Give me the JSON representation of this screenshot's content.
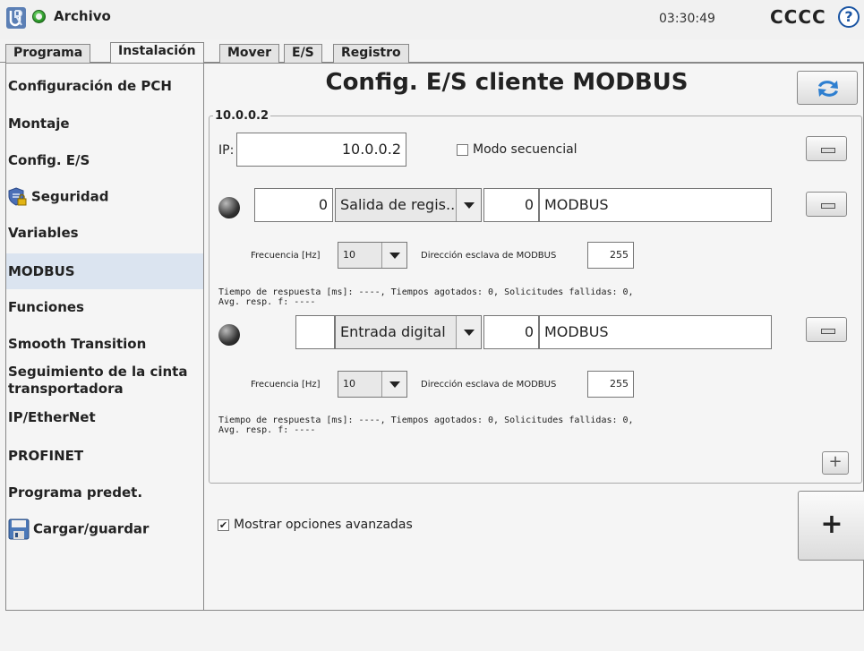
{
  "topbar": {
    "file_label": "Archivo",
    "clock": "03:30:49",
    "robot_name": "CCCC",
    "help": "?"
  },
  "tabs": [
    {
      "label": "Programa",
      "active": false
    },
    {
      "label": "Instalación",
      "active": true
    },
    {
      "label": "Mover",
      "active": false
    },
    {
      "label": "E/S",
      "active": false
    },
    {
      "label": "Registro",
      "active": false
    }
  ],
  "sidebar": {
    "items": [
      {
        "label": "Configuración de PCH"
      },
      {
        "label": "Montaje"
      },
      {
        "label": "Config. E/S"
      },
      {
        "label": "Seguridad",
        "icon": "shield-lock-icon"
      },
      {
        "label": "Variables"
      },
      {
        "label": "MODBUS",
        "active": true
      },
      {
        "label": "Funciones"
      },
      {
        "label": "Smooth Transition"
      },
      {
        "label": "Seguimiento de la cinta transportadora"
      },
      {
        "label": "IP/EtherNet"
      },
      {
        "label": "PROFINET"
      },
      {
        "label": "Programa predet."
      },
      {
        "label": "Cargar/guardar",
        "icon": "floppy-disk-icon"
      }
    ]
  },
  "main": {
    "title": "Config. E/S cliente MODBUS",
    "group_title": "10.0.0.2",
    "ip_label": "IP:",
    "ip_value": "10.0.0.2",
    "sequential_label": "Modo secuencial",
    "sequential_checked": false,
    "signals": [
      {
        "address": "0",
        "type": "Salida de regis...",
        "reg": "0",
        "name": "MODBUS",
        "freq_label": "Frecuencia [Hz]",
        "freq_value": "10",
        "slave_label": "Dirección esclava de MODBUS",
        "slave_value": "255",
        "stats_line1": "Tiempo de respuesta [ms]: ----, Tiempos agotados: 0, Solicitudes fallidas: 0,",
        "stats_line2": "Avg. resp. f: ----"
      },
      {
        "address": "",
        "type": "Entrada digital",
        "reg": "0",
        "name": "MODBUS",
        "freq_label": "Frecuencia [Hz]",
        "freq_value": "10",
        "slave_label": "Dirección esclava de MODBUS",
        "slave_value": "255",
        "stats_line1": "Tiempo de respuesta [ms]: ----, Tiempos agotados: 0, Solicitudes fallidas: 0,",
        "stats_line2": "Avg. resp. f: ----"
      }
    ],
    "advanced_label": "Mostrar opciones avanzadas",
    "advanced_checked": true,
    "add_signal": "+",
    "add_unit": "+"
  }
}
